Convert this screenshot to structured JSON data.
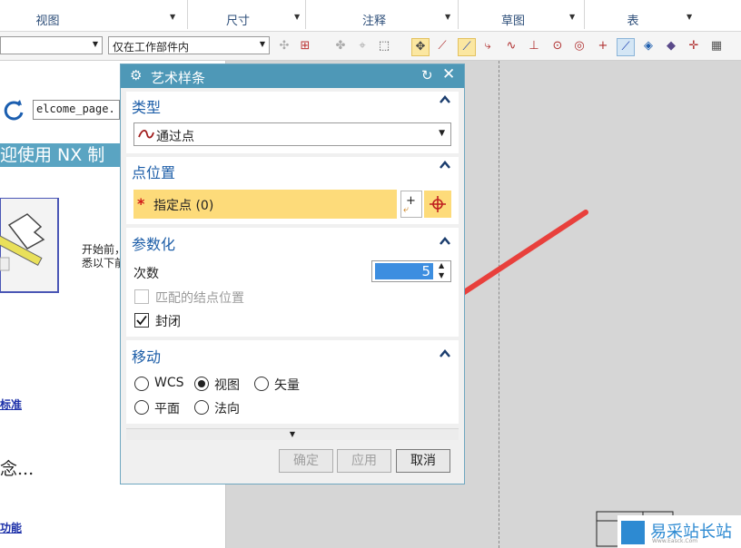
{
  "ribbon": {
    "groups": [
      {
        "label": "视图"
      },
      {
        "label": "尺寸"
      },
      {
        "label": "注释"
      },
      {
        "label": "草图"
      },
      {
        "label": "表"
      }
    ]
  },
  "toolbar": {
    "filter_value": "",
    "scope_value": "仅在工作部件内"
  },
  "welcome": {
    "url_value": "elcome_page.",
    "banner": "迎使用 NX 制",
    "intro_line1": "开始前，",
    "intro_line2": "悉以下前",
    "link1": "标准",
    "heading2": "念...",
    "link2": "功能"
  },
  "dialog": {
    "title": "艺术样条",
    "type_section": {
      "header": "类型",
      "selected": "通过点"
    },
    "point_section": {
      "header": "点位置",
      "specify_label": "指定点 (0)"
    },
    "param_section": {
      "header": "参数化",
      "degree_label": "次数",
      "degree_value": "5",
      "match_knot_label": "匹配的结点位置",
      "closed_label": "封闭",
      "closed_checked": true
    },
    "move_section": {
      "header": "移动",
      "options": [
        "WCS",
        "视图",
        "矢量",
        "平面",
        "法向"
      ],
      "selected": "视图"
    },
    "buttons": {
      "ok": "确定",
      "apply": "应用",
      "cancel": "取消"
    }
  },
  "watermark": {
    "text": "易采站长站",
    "sub": "Www.Easck.Com"
  },
  "colors": {
    "title_bar": "#4e98b7",
    "section_header": "#1d5ea8",
    "point_highlight": "#fddb7a",
    "annotation_arrow": "#e8403c"
  }
}
